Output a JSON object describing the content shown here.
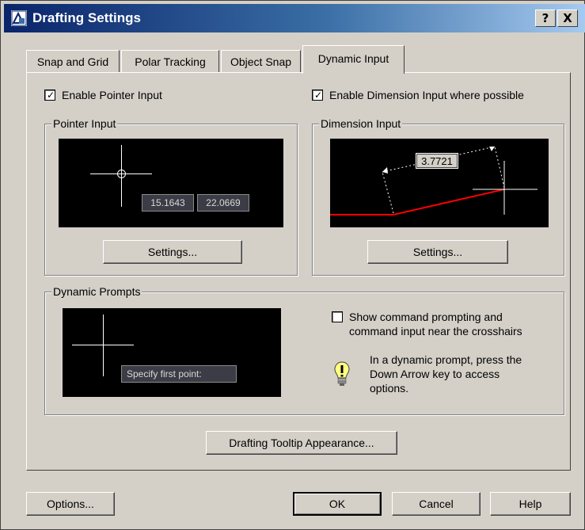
{
  "window": {
    "title": "Drafting Settings",
    "help_button": "?",
    "close_button": "X"
  },
  "tabs": [
    {
      "label": "Snap and Grid"
    },
    {
      "label": "Polar Tracking"
    },
    {
      "label": "Object Snap"
    },
    {
      "label": "Dynamic Input",
      "active": true
    }
  ],
  "pointer": {
    "enable_label": "Enable Pointer Input",
    "enabled": true,
    "group_title": "Pointer Input",
    "x_value": "15.1643",
    "y_value": "22.0669",
    "settings_label": "Settings..."
  },
  "dimension": {
    "enable_label": "Enable Dimension Input where possible",
    "enabled": true,
    "group_title": "Dimension Input",
    "length_value": "3.7721",
    "settings_label": "Settings..."
  },
  "prompts": {
    "group_title": "Dynamic Prompts",
    "prompt_text": "Specify first point:",
    "show_label_line1": "Show command prompting and",
    "show_label_line2": "command input near the crosshairs",
    "show_checked": false,
    "hint_line1": "In a dynamic prompt, press the",
    "hint_line2": "Down Arrow key to access",
    "hint_line3": "options.",
    "hint_icon": "lightbulb-icon"
  },
  "appearance_button": "Drafting Tooltip Appearance...",
  "footer": {
    "options_label": "Options...",
    "ok_label": "OK",
    "cancel_label": "Cancel",
    "help_label": "Help"
  },
  "colors": {
    "title_start": "#0a246a",
    "title_end": "#a6caf0",
    "face": "#d4d0c8",
    "dimension_line": "#ff0000"
  }
}
